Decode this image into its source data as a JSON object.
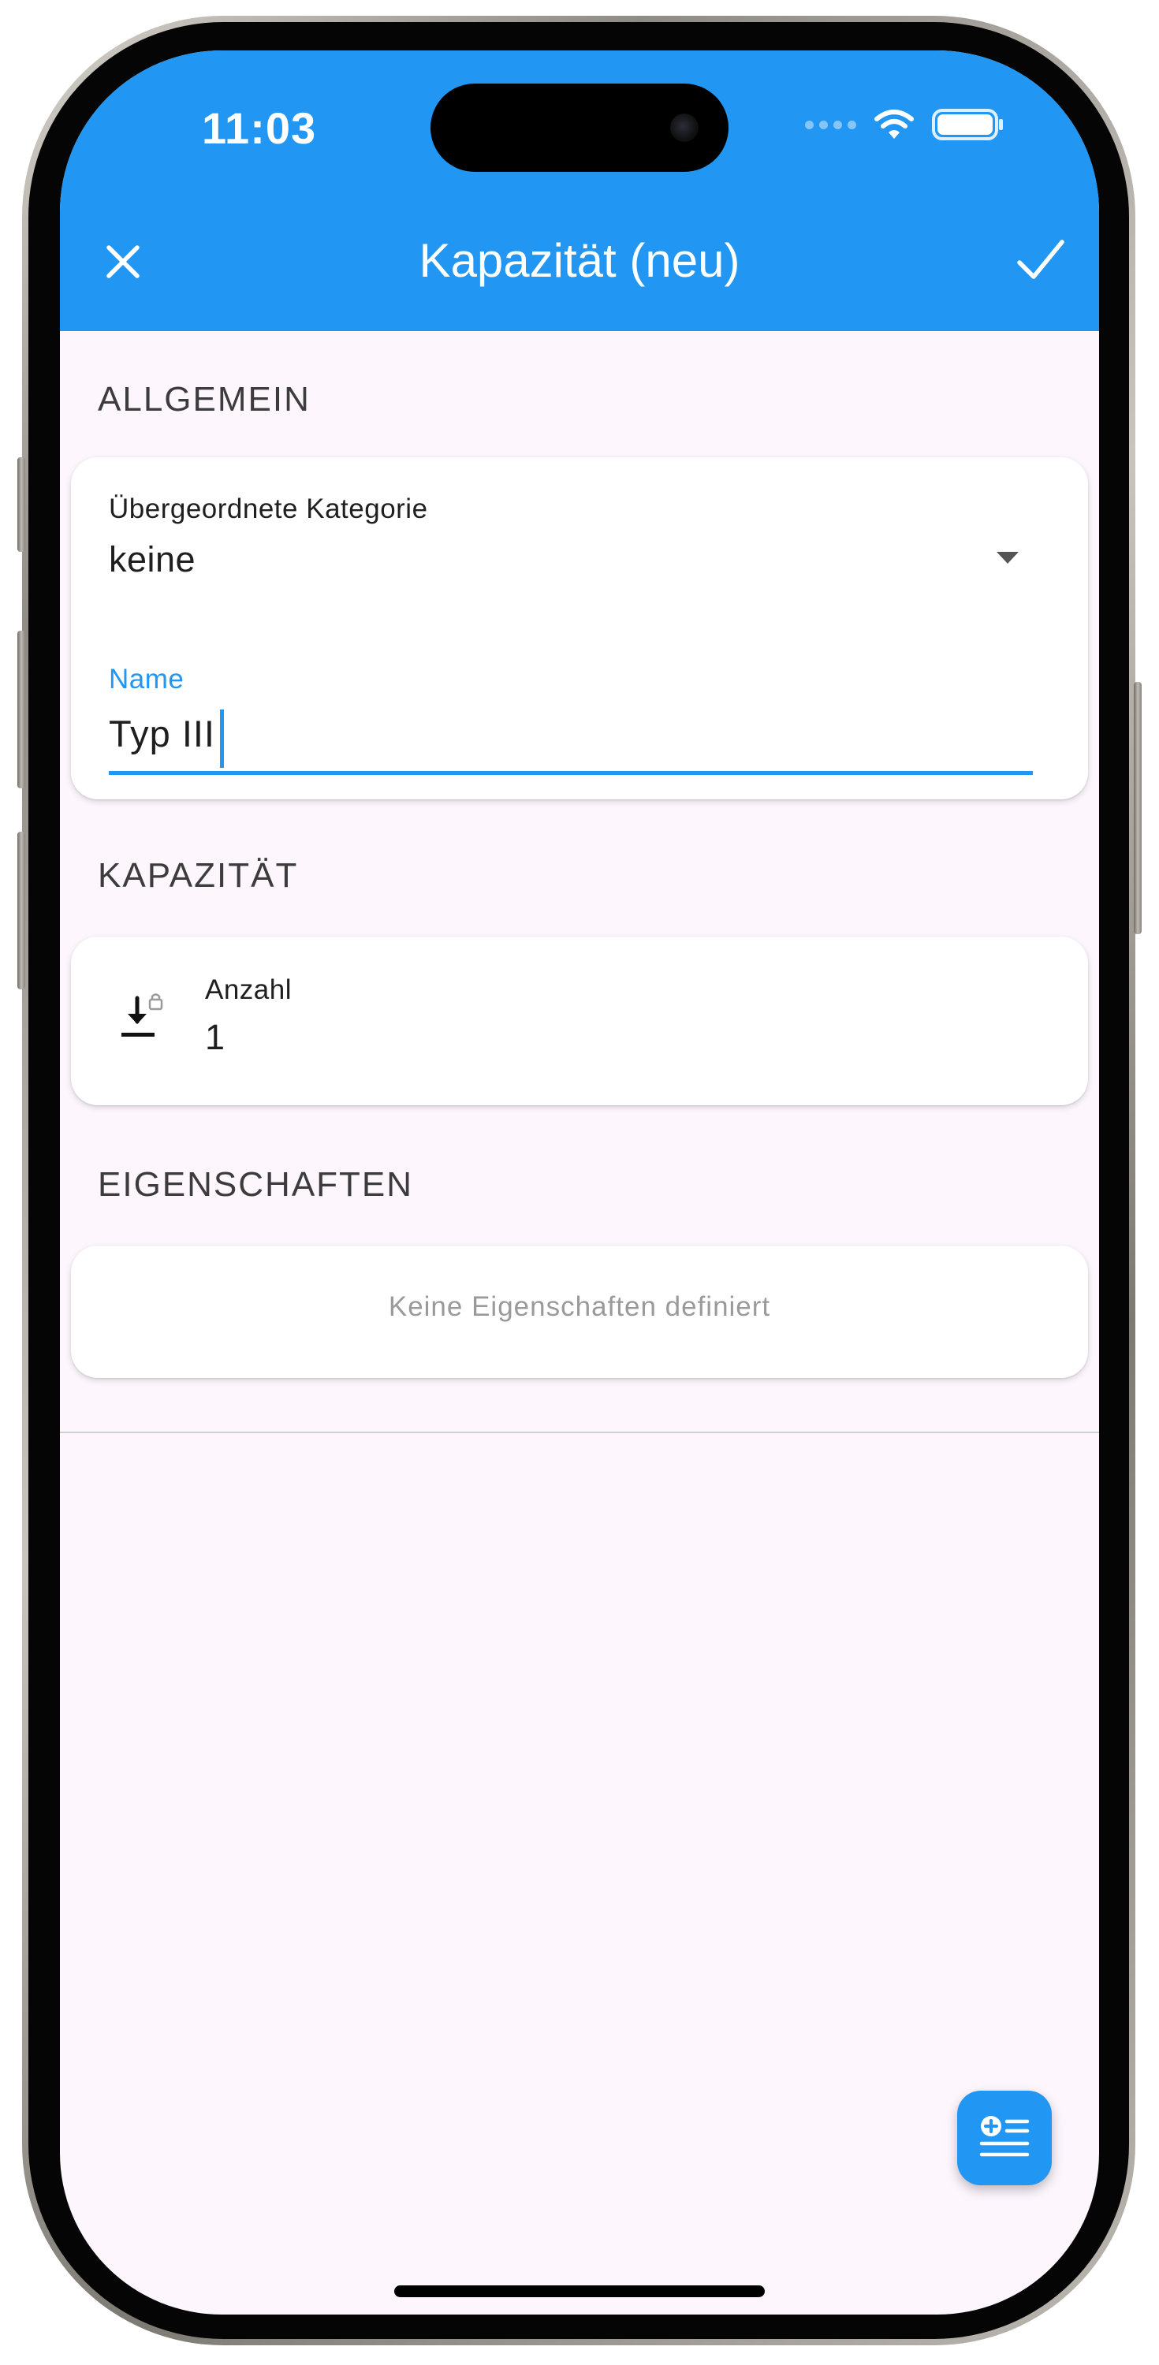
{
  "status_bar": {
    "time": "11:03"
  },
  "app_bar": {
    "title": "Kapazität (neu)",
    "close_icon": "close-icon",
    "save_icon": "check-icon"
  },
  "sections": {
    "general": {
      "header": "ALLGEMEIN",
      "parent_category": {
        "label": "Übergeordnete Kategorie",
        "value": "keine"
      },
      "name": {
        "label": "Name",
        "value": "Typ III"
      }
    },
    "capacity": {
      "header": "KAPAZITÄT",
      "count": {
        "label": "Anzahl",
        "value": "1",
        "icon": "download-lock-icon"
      }
    },
    "properties": {
      "header": "EIGENSCHAFTEN",
      "empty_text": "Keine Eigenschaften definiert"
    }
  },
  "fab": {
    "icon": "add-list-icon"
  },
  "colors": {
    "primary": "#2196f3",
    "background": "#fdf6fd",
    "card": "#ffffff",
    "text": "#1f1f1f",
    "muted": "#9a9a9a"
  }
}
